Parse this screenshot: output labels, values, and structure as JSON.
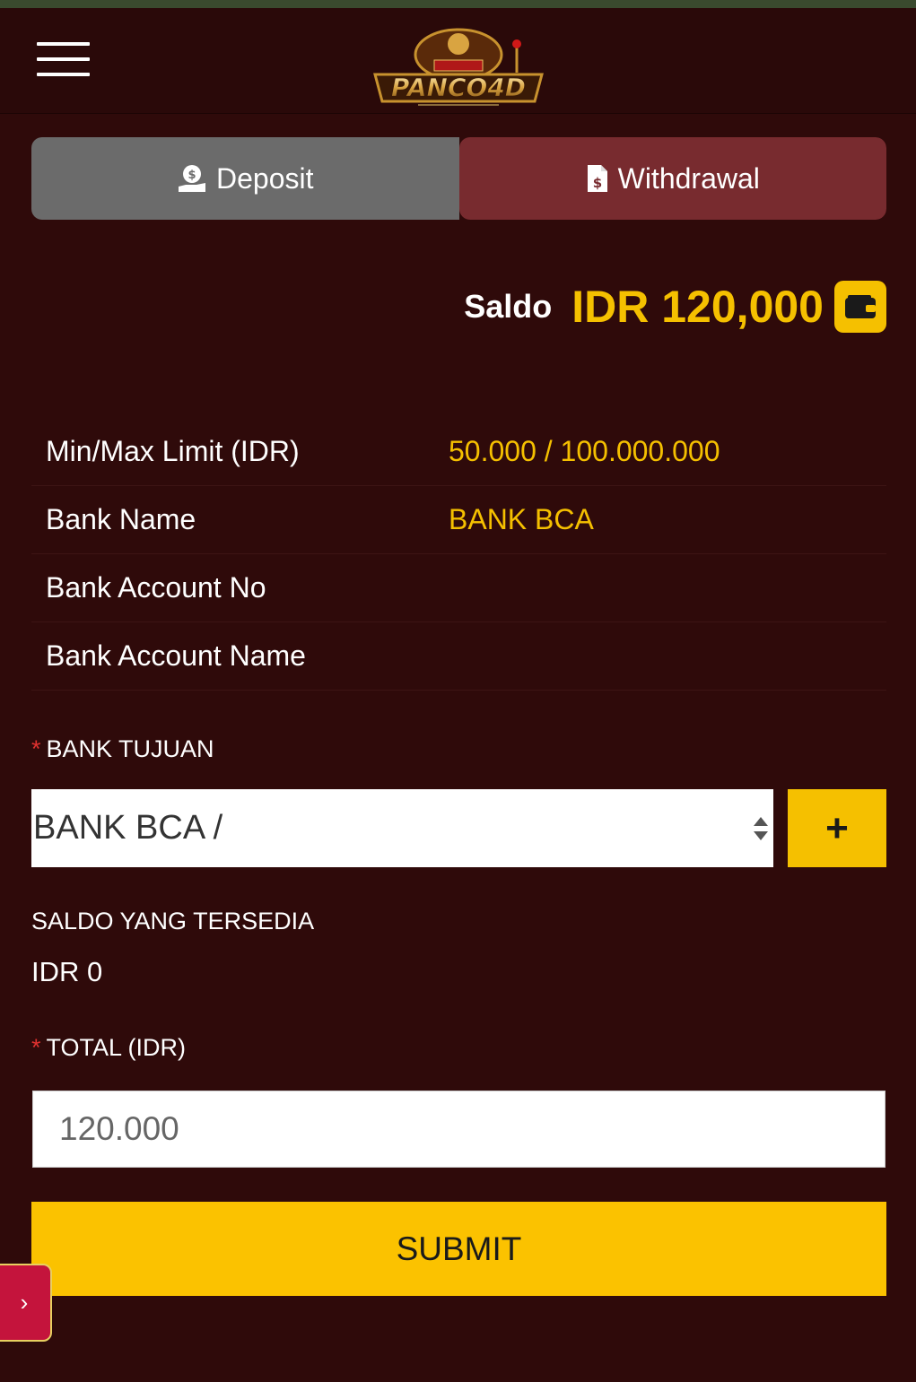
{
  "header": {
    "logo_text": "PANCO4D",
    "menu_icon": "hamburger-menu-icon"
  },
  "tabs": [
    {
      "label": "Deposit",
      "icon": "money-hand-icon",
      "active": false
    },
    {
      "label": "Withdrawal",
      "icon": "dollar-document-icon",
      "active": true
    }
  ],
  "balance": {
    "label": "Saldo",
    "amount": "IDR 120,000",
    "icon": "wallet-icon"
  },
  "info": [
    {
      "key": "Min/Max Limit (IDR)",
      "value": "50.000 / 100.000.000"
    },
    {
      "key": "Bank Name",
      "value": "BANK BCA"
    },
    {
      "key": "Bank Account No",
      "value": ""
    },
    {
      "key": "Bank Account Name",
      "value": ""
    }
  ],
  "form": {
    "bank_label": "BANK TUJUAN",
    "bank_selected": "BANK BCA /",
    "add_label": "+",
    "available_label": "SALDO YANG TERSEDIA",
    "available_value": "IDR 0",
    "total_label": "TOTAL (IDR)",
    "total_value": "120.000",
    "submit_label": "SUBMIT",
    "required_mark": "*"
  },
  "side_toggle": "›",
  "colors": {
    "background": "#2f0a0a",
    "accent": "#f5c000",
    "active_tab": "#782b2f",
    "inactive_tab": "#6b6b6b"
  }
}
